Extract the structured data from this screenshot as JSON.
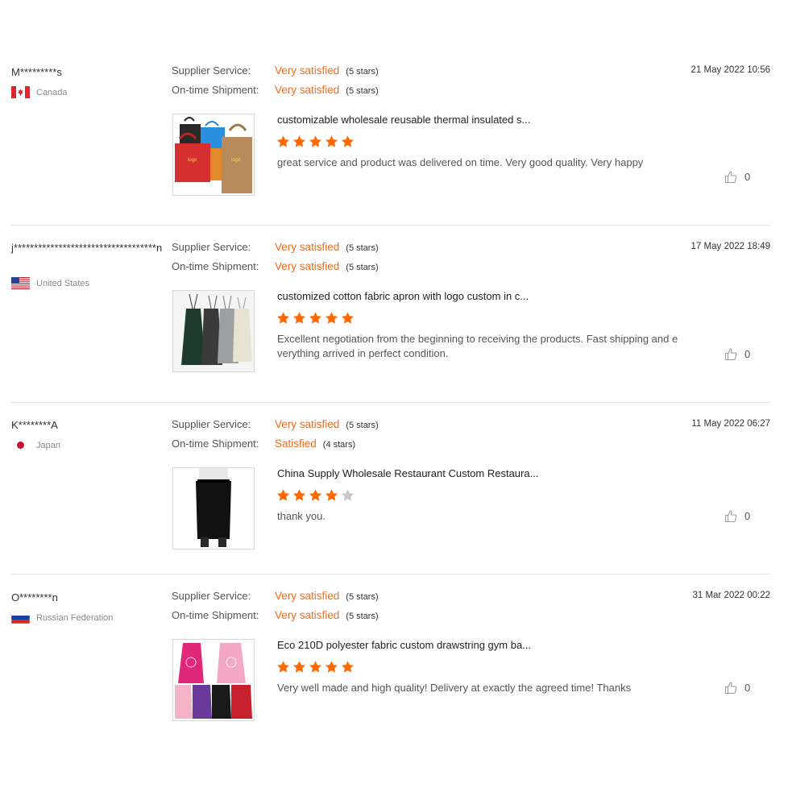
{
  "labels": {
    "supplier_service": "Supplier Service:",
    "ontime_shipment": "On-time Shipment:"
  },
  "colors": {
    "accent": "#ef6c1a",
    "star_on": "#ff6a00",
    "star_off": "#c8c8c8"
  },
  "reviews": [
    {
      "reviewer": "M*********s",
      "country": "Canada",
      "flag": "canada-flag",
      "date": "21 May 2022 10:56",
      "supplier_value": "Very satisfied",
      "supplier_stars": "(5 stars)",
      "shipment_value": "Very satisfied",
      "shipment_stars": "(5 stars)",
      "product_title": "customizable wholesale reusable thermal insulated s...",
      "product_rating": 5,
      "comment": "great service and product was delivered on time.    Very good quality.    Very happy",
      "likes": "0",
      "thumbnail": "tote-bags-image"
    },
    {
      "reviewer": "j***********************************n",
      "country": "United States",
      "flag": "usa-flag",
      "date": "17 May 2022 18:49",
      "supplier_value": "Very satisfied",
      "supplier_stars": "(5 stars)",
      "shipment_value": "Very satisfied",
      "shipment_stars": "(5 stars)",
      "product_title": "customized cotton fabric apron with logo custom in c...",
      "product_rating": 5,
      "comment": "Excellent negotiation from the beginning to receiving the products. Fast shipping and everything arrived in perfect condition.",
      "likes": "0",
      "thumbnail": "aprons-image"
    },
    {
      "reviewer": "K********A",
      "country": "Japan",
      "flag": "japan-flag",
      "date": "11 May 2022 06:27",
      "supplier_value": "Very satisfied",
      "supplier_stars": "(5 stars)",
      "shipment_value": "Satisfied",
      "shipment_stars": "(4 stars)",
      "product_title": "China Supply Wholesale Restaurant Custom Restaura...",
      "product_rating": 4,
      "comment": "thank you.",
      "likes": "0",
      "thumbnail": "waist-apron-image"
    },
    {
      "reviewer": "O********n",
      "country": "Russian Federation",
      "flag": "russia-flag",
      "date": "31 Mar 2022 00:22",
      "supplier_value": "Very satisfied",
      "supplier_stars": "(5 stars)",
      "shipment_value": "Very satisfied",
      "shipment_stars": "(5 stars)",
      "product_title": "Eco 210D polyester fabric custom drawstring gym ba...",
      "product_rating": 5,
      "comment": "Very well made and high quality! Delivery at exactly the agreed time! Thanks",
      "likes": "0",
      "thumbnail": "drawstring-bags-image"
    }
  ]
}
